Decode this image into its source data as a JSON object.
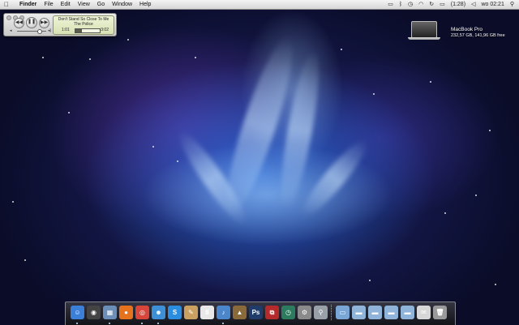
{
  "menubar": {
    "apple": "",
    "items": [
      "Finder",
      "File",
      "Edit",
      "View",
      "Go",
      "Window",
      "Help"
    ],
    "status": {
      "battery": "(1:28)",
      "clock": "wo 02:21"
    },
    "status_icons": [
      "display-icon",
      "bluetooth-icon",
      "time-machine-icon",
      "wifi-icon",
      "sync-icon",
      "battery-icon",
      "volume-icon",
      "search-icon"
    ]
  },
  "mini_player": {
    "song": "Don't Stand So Close To Me",
    "artist": "The Police",
    "elapsed": "1:01",
    "remaining": "-3:02",
    "progress": 0.25,
    "volume": 0.75
  },
  "disk": {
    "name": "MacBook Pro",
    "info": "232,57 GB, 141,96 GB free"
  },
  "dock": {
    "apps": [
      {
        "name": "finder",
        "glyph": "☺",
        "color": "#3b7fd9",
        "running": true
      },
      {
        "name": "dashboard",
        "glyph": "◉",
        "color": "#444",
        "running": false
      },
      {
        "name": "preview",
        "glyph": "▦",
        "color": "#6b8fb8",
        "running": true
      },
      {
        "name": "firefox",
        "glyph": "●",
        "color": "#e5731e",
        "running": false
      },
      {
        "name": "chrome",
        "glyph": "◎",
        "color": "#d8453b",
        "running": true
      },
      {
        "name": "ichat",
        "glyph": "☻",
        "color": "#3d8fd6",
        "running": true
      },
      {
        "name": "skype",
        "glyph": "S",
        "color": "#2a8de0",
        "running": false
      },
      {
        "name": "notes",
        "glyph": "✎",
        "color": "#caa160",
        "running": false
      },
      {
        "name": "ical",
        "glyph": "8",
        "color": "#e8e8e8",
        "running": false
      },
      {
        "name": "itunes",
        "glyph": "♪",
        "color": "#4a86c9",
        "running": true
      },
      {
        "name": "iphoto",
        "glyph": "▲",
        "color": "#8a6a3a",
        "running": false
      },
      {
        "name": "photoshop",
        "glyph": "Ps",
        "color": "#1f3c6b",
        "running": false
      },
      {
        "name": "parallels",
        "glyph": "⧉",
        "color": "#b52a2a",
        "running": false
      },
      {
        "name": "time-machine",
        "glyph": "◷",
        "color": "#2d7b5f",
        "running": false
      },
      {
        "name": "system-preferences",
        "glyph": "⚙",
        "color": "#8a8a8a",
        "running": false
      },
      {
        "name": "automator",
        "glyph": "⚲",
        "color": "#9aa0a8",
        "running": false
      }
    ],
    "stacks": [
      {
        "name": "downloads-stack",
        "glyph": "▭",
        "color": "#7aa6d6"
      },
      {
        "name": "folder-1",
        "glyph": "▬",
        "color": "#8fb3d9"
      },
      {
        "name": "folder-2",
        "glyph": "▬",
        "color": "#8fb3d9"
      },
      {
        "name": "folder-3",
        "glyph": "▬",
        "color": "#8fb3d9"
      },
      {
        "name": "folder-4",
        "glyph": "▬",
        "color": "#8fb3d9"
      },
      {
        "name": "mail-stack",
        "glyph": "✉",
        "color": "#d7d7d7"
      },
      {
        "name": "trash",
        "glyph": "🗑",
        "color": "#9a9a9a"
      }
    ]
  }
}
